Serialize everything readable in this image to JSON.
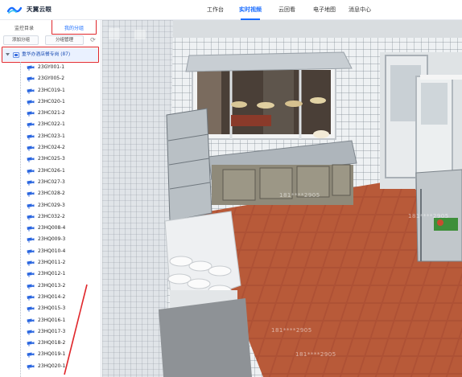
{
  "header": {
    "brand": "天翼云眼",
    "nav": [
      "工作台",
      "实时视频",
      "云回看",
      "电子地图",
      "消息中心"
    ],
    "active_nav": "实时视频"
  },
  "sidebar": {
    "tabs": [
      "监控目录",
      "我的分组"
    ],
    "buttons": [
      "添加分组",
      "分组管理"
    ],
    "group_label": "重华办酒店餐专岗 (87)",
    "cameras": [
      "23GY001-1",
      "23GY005-2",
      "23HC019-1",
      "23HC020-1",
      "23HC021-2",
      "23HC022-1",
      "23HC023-1",
      "23HC024-2",
      "23HC025-3",
      "23HC026-1",
      "23HC027-3",
      "23HC028-2",
      "23HC029-3",
      "23HC032-2",
      "23HQ008-4",
      "23HQ009-3",
      "23HQ010-4",
      "23HQ011-2",
      "23HQ012-1",
      "23HQ013-2",
      "23HQ014-2",
      "23HQ015-3",
      "23HQ016-1",
      "23HQ017-3",
      "23HQ018-2",
      "23HQ019-1",
      "23HQ020-1"
    ]
  },
  "video": {
    "watermarks": [
      "181****2905",
      "181****2905",
      "181****2905",
      "181****2905"
    ]
  },
  "colors": {
    "accent": "#1a6dff",
    "highlight": "#e0262b",
    "floor": "#b5553a",
    "wall": "#e9edf0"
  }
}
